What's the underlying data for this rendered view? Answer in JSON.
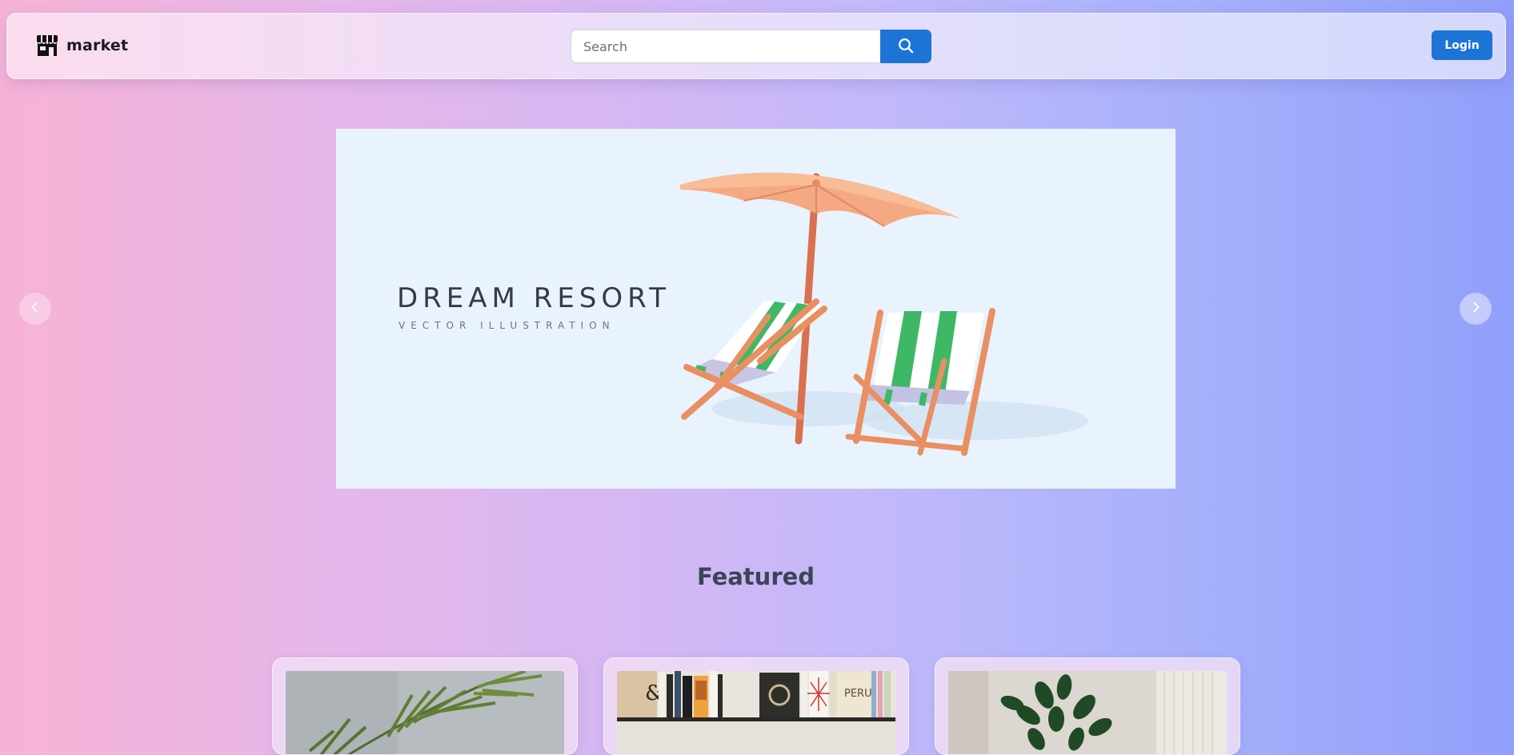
{
  "header": {
    "brand_name": "market",
    "brand_icon": "storefront-icon",
    "search": {
      "placeholder": "Search",
      "value": "",
      "button_icon": "search-icon"
    },
    "login_label": "Login"
  },
  "carousel": {
    "prev_icon": "chevron-left-icon",
    "next_icon": "chevron-right-icon",
    "slide": {
      "title": "DREAM RESORT",
      "subtitle": "VECTOR ILLUSTRATION",
      "art": "beach-umbrella-and-deck-chairs-illustration"
    }
  },
  "featured": {
    "title": "Featured",
    "cards": [
      {
        "image": "palm-plant-photo"
      },
      {
        "image": "bookshelf-photo",
        "visible_text": [
          "&",
          "PERU"
        ]
      },
      {
        "image": "potted-plant-photo"
      }
    ]
  },
  "colors": {
    "accent": "#1c74d6",
    "banner_background": "#e8f3fd",
    "gradient_left": "#f7b3d6",
    "gradient_right": "#909ffa"
  }
}
